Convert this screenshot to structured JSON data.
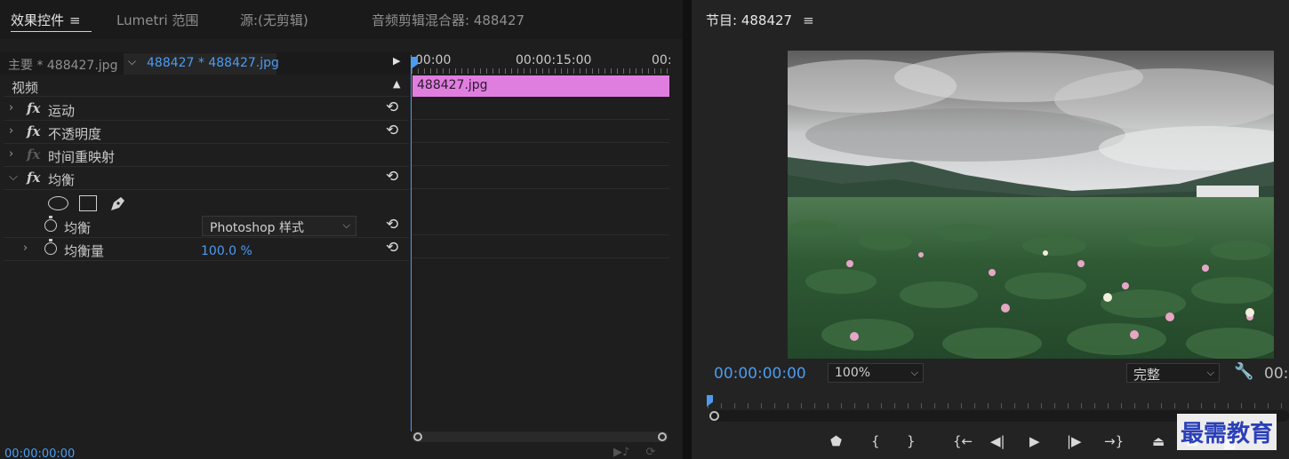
{
  "left_panel": {
    "tabs": [
      {
        "label": "效果控件"
      },
      {
        "label": "Lumetri 范围"
      },
      {
        "label": "源:(无剪辑)"
      },
      {
        "label": "音频剪辑混合器: 488427"
      }
    ],
    "menu_glyph": "≡",
    "sequence": {
      "master_label": "主要 * 488427.jpg",
      "clip_label": "488427 * 488427.jpg"
    },
    "section_header": "视频",
    "effects": [
      {
        "label": "运动",
        "fx": "fx"
      },
      {
        "label": "不透明度",
        "fx": "fx"
      },
      {
        "label": "时间重映射",
        "fx": "fx"
      },
      {
        "label": "均衡",
        "fx": "fx"
      }
    ],
    "properties": {
      "equalize_label": "均衡",
      "equalize_value": "Photoshop 样式",
      "amount_label": "均衡量",
      "amount_value": "100.0 %"
    },
    "bottom_timecode": "00:00:00:00"
  },
  "mini_timeline": {
    "ruler_labels": [
      "00:00",
      "00:00:15:00",
      "00:"
    ],
    "clip_name": "488427.jpg"
  },
  "program_monitor": {
    "title": "节目: 488427",
    "timecode": "00:00:00:00",
    "zoom": "100%",
    "quality": "完整",
    "duration_timecode": "00:",
    "watermark_text": "最需教育"
  },
  "colors": {
    "accent_blue": "#4c9bf0",
    "clip_pink": "#e07ee0",
    "panel_bg": "#1e1e1e",
    "watermark_blue": "#2a3fb8"
  },
  "icons": [
    "menu-icon",
    "chevron-down-icon",
    "play-icon",
    "collapse-icon",
    "chevron-right-icon",
    "fx-icon",
    "reset-icon",
    "stopwatch-icon",
    "ellipse-mask-icon",
    "rect-mask-icon",
    "pen-mask-icon",
    "wrench-icon",
    "add-marker-icon",
    "mark-in-icon",
    "mark-out-icon",
    "go-to-in-icon",
    "step-back-icon",
    "play-icon",
    "step-forward-icon",
    "go-to-out-icon",
    "lift-icon",
    "extract-icon",
    "export-frame-icon"
  ]
}
